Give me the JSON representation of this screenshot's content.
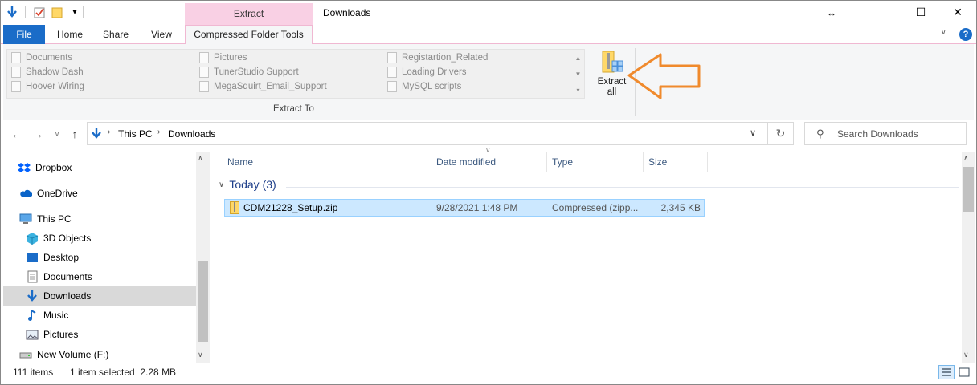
{
  "window": {
    "title": "Downloads",
    "context_tab_header": "Extract",
    "minimize_symbol": "—",
    "maximize_symbol": "☐",
    "close_symbol": "✕",
    "resize_symbol": "↔"
  },
  "ribbon_tabs": {
    "file": "File",
    "home": "Home",
    "share": "Share",
    "view": "View",
    "compressed": "Compressed Folder Tools"
  },
  "extract_to": {
    "group_label": "Extract To",
    "items": [
      "Documents",
      "Shadow Dash",
      "Hoover Wiring",
      "Pictures",
      "TunerStudio Support",
      "MegaSquirt_Email_Support",
      "Registartion_Related",
      "Loading Drivers",
      "MySQL scripts"
    ]
  },
  "extract_all": {
    "label_line1": "Extract",
    "label_line2": "all"
  },
  "address": {
    "crumbs": [
      "This PC",
      "Downloads"
    ],
    "search_placeholder": "Search Downloads"
  },
  "nav": {
    "items": [
      {
        "label": "Dropbox",
        "icon": "dropbox-icon"
      },
      {
        "label": "OneDrive",
        "icon": "onedrive-icon"
      },
      {
        "label": "This PC",
        "icon": "this-pc-icon"
      },
      {
        "label": "3D Objects",
        "icon": "3d-objects-icon"
      },
      {
        "label": "Desktop",
        "icon": "desktop-icon"
      },
      {
        "label": "Documents",
        "icon": "documents-icon"
      },
      {
        "label": "Downloads",
        "icon": "downloads-icon"
      },
      {
        "label": "Music",
        "icon": "music-icon"
      },
      {
        "label": "Pictures",
        "icon": "pictures-icon"
      },
      {
        "label": "New Volume (F:)",
        "icon": "drive-icon"
      }
    ]
  },
  "columns": {
    "name": "Name",
    "date": "Date modified",
    "type": "Type",
    "size": "Size"
  },
  "group": {
    "label": "Today (3)"
  },
  "files": [
    {
      "name": "CDM21228_Setup.zip",
      "date": "9/28/2021 1:48 PM",
      "type": "Compressed (zipp...",
      "size": "2,345 KB"
    }
  ],
  "status": {
    "count": "111 items",
    "selection": "1 item selected  2.28 MB"
  },
  "colors": {
    "accent": "#1a6cc8",
    "context_tab": "#f9d0e4",
    "selection": "#cce8ff",
    "annotation_arrow": "#f08a2c"
  }
}
